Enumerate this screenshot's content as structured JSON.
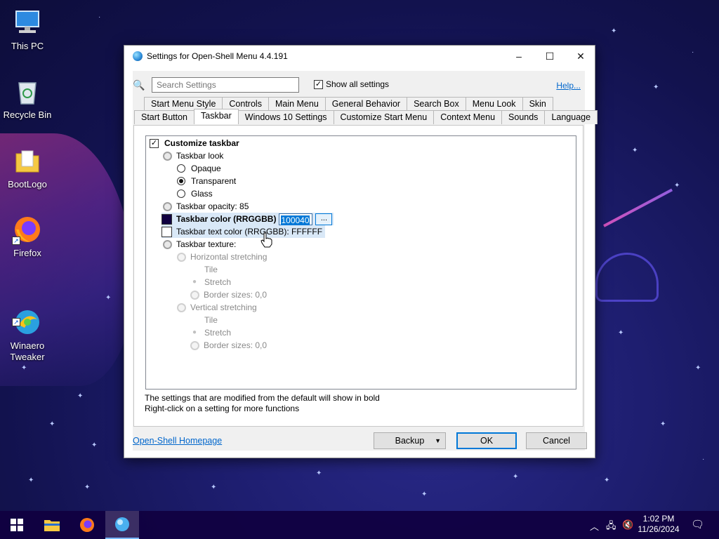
{
  "desktop": {
    "icons": [
      {
        "label": "This PC"
      },
      {
        "label": "Recycle Bin"
      },
      {
        "label": "BootLogo"
      },
      {
        "label": "Firefox"
      },
      {
        "label": "Winaero\nTweaker"
      }
    ]
  },
  "window": {
    "title": "Settings for Open-Shell Menu 4.4.191",
    "minimize": "–",
    "maximize": "☐",
    "close": "✕"
  },
  "toolbar": {
    "search_placeholder": "Search Settings",
    "show_all_label": "Show all settings",
    "show_all_checked": "✓",
    "help_label": "Help..."
  },
  "tabs": {
    "row1": [
      "Start Menu Style",
      "Controls",
      "Main Menu",
      "General Behavior",
      "Search Box",
      "Menu Look",
      "Skin"
    ],
    "row2": [
      "Start Button",
      "Taskbar",
      "Windows 10 Settings",
      "Customize Start Menu",
      "Context Menu",
      "Sounds",
      "Language"
    ],
    "active": "Taskbar"
  },
  "tree": {
    "customize_check": "✓",
    "customize_label": "Customize taskbar",
    "look_label": "Taskbar look",
    "opaque": "Opaque",
    "transparent": "Transparent",
    "glass": "Glass",
    "opacity": "Taskbar opacity: 85",
    "color_label": "Taskbar color (RRGGBB)",
    "color_value": "100040",
    "color_button": "...",
    "color_swatch": "#100040",
    "text_color": "Taskbar text color (RRGGBB): FFFFFF",
    "text_swatch": "#FFFFFF",
    "texture": "Taskbar texture:",
    "h_stretch": "Horizontal stretching",
    "h_tile": "Tile",
    "h_stretch_opt": "Stretch",
    "h_border": "Border sizes: 0,0",
    "v_stretch": "Vertical stretching",
    "v_tile": "Tile",
    "v_stretch_opt": "Stretch",
    "v_border": "Border sizes: 0,0"
  },
  "hints": {
    "line1": "The settings that are modified from the default will show in bold",
    "line2": "Right-click on a setting for more functions"
  },
  "footer": {
    "homepage": "Open-Shell Homepage",
    "backup": "Backup",
    "ok": "OK",
    "cancel": "Cancel"
  },
  "taskbar": {
    "time": "1:02 PM",
    "date": "11/26/2024",
    "color": "#100040"
  }
}
